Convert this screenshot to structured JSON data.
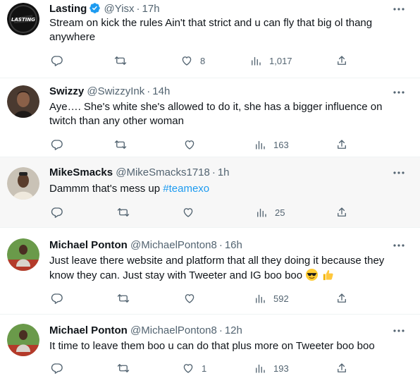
{
  "colors": {
    "text": "#0f1419",
    "secondary": "#536471",
    "link": "#1d9bf0",
    "verified": "#1d9bf0",
    "divider": "#eff3f4",
    "highlight_bg": "#f7f7f7"
  },
  "tweets": [
    {
      "name": "Lasting",
      "verified": true,
      "handle": "@Yisx",
      "time": "17h",
      "text": "Stream on kick the rules Ain't that strict and u can fly that big ol thang anywhere",
      "replies": "",
      "retweets": "",
      "likes": "8",
      "views": "1,017"
    },
    {
      "name": "Swizzy",
      "verified": false,
      "handle": "@SwizzyInk",
      "time": "14h",
      "text": "Aye…. She's white she's allowed to do it, she has a bigger influence on twitch than any other woman",
      "replies": "",
      "retweets": "",
      "likes": "",
      "views": "163"
    },
    {
      "name": "MikeSmacks",
      "verified": false,
      "handle": "@MikeSmacks1718",
      "time": "1h",
      "text": "Dammm that's mess up ",
      "hashtag": "#teamexo",
      "replies": "",
      "retweets": "",
      "likes": "",
      "views": "25"
    },
    {
      "name": "Michael Ponton",
      "verified": false,
      "handle": "@MichaelPonton8",
      "time": "16h",
      "text": "Just leave there website  and platform that all they doing it because they know they can. Just stay with Tweeter and IG boo boo",
      "emojis": [
        "sunglasses-emoji",
        "thumbs-up-emoji"
      ],
      "replies": "",
      "retweets": "",
      "likes": "",
      "views": "592"
    },
    {
      "name": "Michael Ponton",
      "verified": false,
      "handle": "@MichaelPonton8",
      "time": "12h",
      "text": "It time to leave them boo u can do that plus more on Tweeter boo boo",
      "replies": "",
      "retweets": "",
      "likes": "1",
      "views": "193"
    }
  ],
  "avatar_logo_text": "LASTING",
  "separator": "·",
  "icons": {
    "more": "more-dots-icon",
    "reply": "reply-icon",
    "retweet": "retweet-icon",
    "like": "heart-icon",
    "views": "views-chart-icon",
    "share": "share-icon",
    "verified": "verified-badge-icon"
  }
}
